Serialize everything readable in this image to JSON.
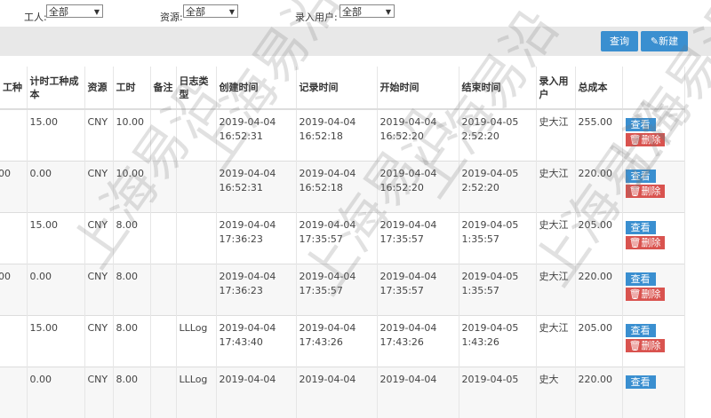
{
  "filters": {
    "worker_label": "工人:",
    "worker_value": "全部",
    "resource_label": "资源:",
    "resource_value": "全部",
    "entry_user_label": "录入用户:",
    "entry_user_value": "全部"
  },
  "toolbar": {
    "query_label": "查询",
    "new_label": "✎新建"
  },
  "table": {
    "headers": [
      "工种",
      "计时工种成本",
      "资源",
      "工时",
      "备注",
      "日志类型",
      "创建时间",
      "记录时间",
      "开始时间",
      "结束时间",
      "录入用户",
      "总成本",
      ""
    ],
    "rows": [
      [
        "",
        "15.00",
        "CNY",
        "10.00",
        "",
        "",
        "2019-04-04 16:52:31",
        "2019-04-04 16:52:18",
        "2019-04-04 16:52:20",
        "2019-04-05 2:52:20",
        "史大江",
        "255.00"
      ],
      [
        "00",
        "0.00",
        "CNY",
        "10.00",
        "",
        "",
        "2019-04-04 16:52:31",
        "2019-04-04 16:52:18",
        "2019-04-04 16:52:20",
        "2019-04-05 2:52:20",
        "史大江",
        "220.00"
      ],
      [
        "",
        "15.00",
        "CNY",
        "8.00",
        "",
        "",
        "2019-04-04 17:36:23",
        "2019-04-04 17:35:57",
        "2019-04-04 17:35:57",
        "2019-04-05 1:35:57",
        "史大江",
        "205.00"
      ],
      [
        "00",
        "0.00",
        "CNY",
        "8.00",
        "",
        "",
        "2019-04-04 17:36:23",
        "2019-04-04 17:35:57",
        "2019-04-04 17:35:57",
        "2019-04-05 1:35:57",
        "史大江",
        "220.00"
      ],
      [
        "",
        "15.00",
        "CNY",
        "8.00",
        "",
        "LLLog",
        "2019-04-04 17:43:40",
        "2019-04-04 17:43:26",
        "2019-04-04 17:43:26",
        "2019-04-05 1:43:26",
        "史大江",
        "205.00"
      ],
      [
        "",
        "0.00",
        "CNY",
        "8.00",
        "",
        "LLLog",
        "2019-04-04",
        "2019-04-04",
        "2019-04-04",
        "2019-04-05",
        "史大",
        "220.00"
      ]
    ],
    "view_label": "查看",
    "delete_label": "🗑删除"
  },
  "watermark_text": "上海易沿"
}
